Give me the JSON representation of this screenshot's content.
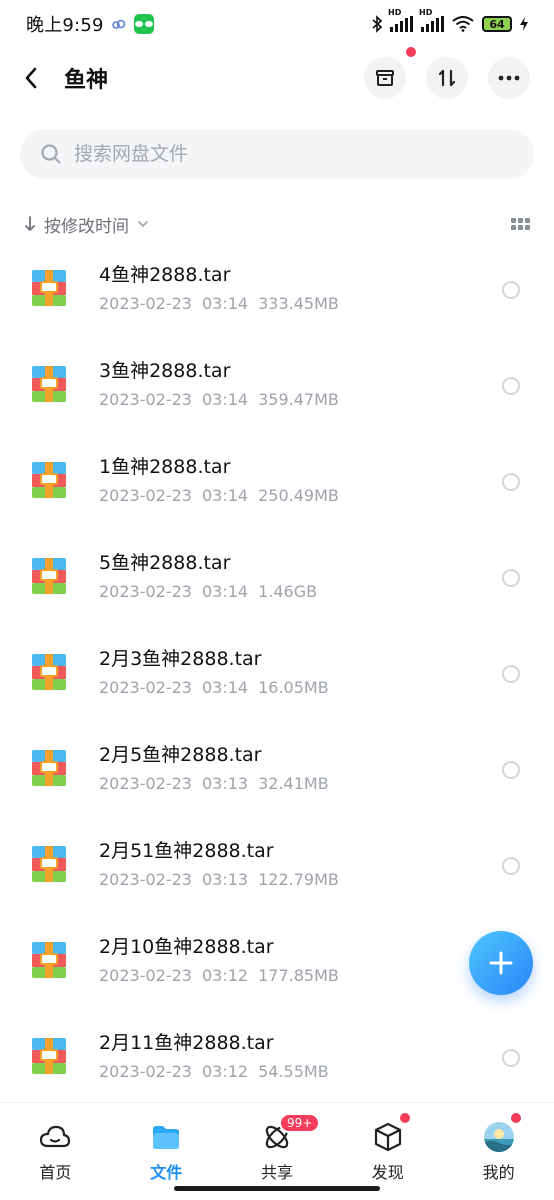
{
  "status_bar": {
    "time": "晚上9:59",
    "battery": "64",
    "signal_label": "HD"
  },
  "header": {
    "title": "鱼神"
  },
  "search": {
    "placeholder": "搜索网盘文件"
  },
  "sort": {
    "label": "按修改时间"
  },
  "files": [
    {
      "name": "4鱼神2888.tar",
      "date": "2023-02-23",
      "time": "03:14",
      "size": "333.45MB"
    },
    {
      "name": "3鱼神2888.tar",
      "date": "2023-02-23",
      "time": "03:14",
      "size": "359.47MB"
    },
    {
      "name": "1鱼神2888.tar",
      "date": "2023-02-23",
      "time": "03:14",
      "size": "250.49MB"
    },
    {
      "name": "5鱼神2888.tar",
      "date": "2023-02-23",
      "time": "03:14",
      "size": "1.46GB"
    },
    {
      "name": "2月3鱼神2888.tar",
      "date": "2023-02-23",
      "time": "03:14",
      "size": "16.05MB"
    },
    {
      "name": "2月5鱼神2888.tar",
      "date": "2023-02-23",
      "time": "03:13",
      "size": "32.41MB"
    },
    {
      "name": "2月51鱼神2888.tar",
      "date": "2023-02-23",
      "time": "03:13",
      "size": "122.79MB"
    },
    {
      "name": "2月10鱼神2888.tar",
      "date": "2023-02-23",
      "time": "03:12",
      "size": "177.85MB"
    },
    {
      "name": "2月11鱼神2888.tar",
      "date": "2023-02-23",
      "time": "03:12",
      "size": "54.55MB"
    }
  ],
  "bottom_nav": {
    "items": [
      {
        "label": "首页",
        "icon": "cloud-icon"
      },
      {
        "label": "文件",
        "icon": "folder-icon"
      },
      {
        "label": "共享",
        "icon": "atom-icon",
        "badge": "99+"
      },
      {
        "label": "发现",
        "icon": "cube-icon"
      },
      {
        "label": "我的",
        "icon": "avatar-icon"
      }
    ]
  },
  "colors": {
    "accent": "#1d8ff4",
    "badge": "#f43d5b",
    "fab": "#2a86f6"
  }
}
